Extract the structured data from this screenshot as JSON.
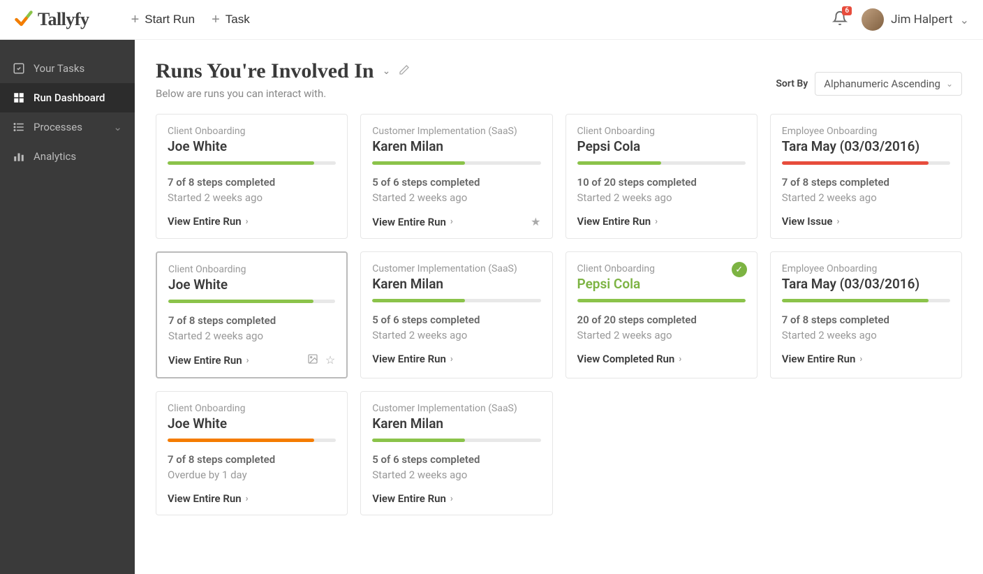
{
  "brand": "Tallyfy",
  "header": {
    "start_run": "Start Run",
    "task": "Task",
    "notif_count": "6",
    "user_name": "Jim Halpert"
  },
  "sidebar": {
    "items": [
      {
        "label": "Your Tasks",
        "icon": "check-square"
      },
      {
        "label": "Run Dashboard",
        "icon": "grid",
        "active": true
      },
      {
        "label": "Processes",
        "icon": "list",
        "expandable": true
      },
      {
        "label": "Analytics",
        "icon": "bars"
      }
    ]
  },
  "page": {
    "title": "Runs You're Involved In",
    "subtitle": "Below are runs you can interact with.",
    "sort_label": "Sort By",
    "sort_value": "Alphanumeric Ascending"
  },
  "colors": {
    "green": "#8bc34a",
    "red": "#e74c3c",
    "orange": "#f57c00"
  },
  "cards": [
    {
      "category": "Client Onboarding",
      "title": "Joe White",
      "progress": 87,
      "color": "#8bc34a",
      "steps": "7 of 8 steps completed",
      "started": "Started 2 weeks ago",
      "action": "View Entire Run"
    },
    {
      "category": "Customer Implementation (SaaS)",
      "title": "Karen Milan",
      "progress": 55,
      "color": "#8bc34a",
      "steps": "5 of 6 steps completed",
      "started": "Started 2 weeks ago",
      "action": "View Entire Run",
      "star": true
    },
    {
      "category": "Client Onboarding",
      "title": "Pepsi Cola",
      "progress": 50,
      "color": "#8bc34a",
      "steps": "10 of 20 steps completed",
      "started": "Started 2 weeks ago",
      "action": "View Entire Run"
    },
    {
      "category": "Employee Onboarding",
      "title": "Tara May (03/03/2016)",
      "progress": 87,
      "color": "#e74c3c",
      "steps": "7 of 8 steps completed",
      "started": "Started 2 weeks ago",
      "action": "View Issue"
    },
    {
      "category": "Client Onboarding",
      "title": "Joe White",
      "progress": 87,
      "color": "#8bc34a",
      "steps": "7 of 8 steps completed",
      "started": "Started 2 weeks ago",
      "action": "View Entire Run",
      "selected": true,
      "image_icon": true,
      "star_outline": true
    },
    {
      "category": "Customer Implementation (SaaS)",
      "title": "Karen Milan",
      "progress": 55,
      "color": "#8bc34a",
      "steps": "5 of 6 steps completed",
      "started": "Started 2 weeks ago",
      "action": "View Entire Run"
    },
    {
      "category": "Client Onboarding",
      "title": "Pepsi Cola",
      "progress": 100,
      "color": "#8bc34a",
      "steps": "20 of 20 steps completed",
      "started": "Started 2 weeks ago",
      "action": "View Completed Run",
      "complete": true,
      "check": true
    },
    {
      "category": "Employee Onboarding",
      "title": "Tara May (03/03/2016)",
      "progress": 87,
      "color": "#8bc34a",
      "steps": "7 of 8 steps completed",
      "started": "Started 2 weeks ago",
      "action": "View Entire Run"
    },
    {
      "category": "Client Onboarding",
      "title": "Joe White",
      "progress": 87,
      "color": "#f57c00",
      "steps": "7 of 8 steps completed",
      "started": "Overdue by 1 day",
      "action": "View Entire Run"
    },
    {
      "category": "Customer Implementation (SaaS)",
      "title": "Karen Milan",
      "progress": 55,
      "color": "#8bc34a",
      "steps": "5 of 6 steps completed",
      "started": "Started 2 weeks ago",
      "action": "View Entire Run"
    }
  ]
}
